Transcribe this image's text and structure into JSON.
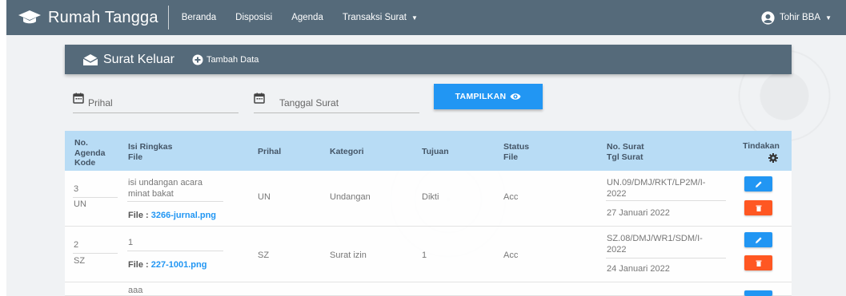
{
  "navbar": {
    "brand": "Rumah Tangga",
    "items": [
      "Beranda",
      "Disposisi",
      "Agenda",
      "Transaksi Surat"
    ],
    "user": "Tohir BBA"
  },
  "panel": {
    "title": "Surat Keluar",
    "add_label": "Tambah Data"
  },
  "filter": {
    "prihal_placeholder": "Prihal",
    "tanggal_placeholder": "Tanggal Surat",
    "button_label": "TAMPILKAN"
  },
  "table": {
    "headers": {
      "no_agenda": "No.",
      "no_agenda_2": "Agenda",
      "kode": "Kode",
      "isi": "Isi Ringkas",
      "file": "File",
      "prihal": "Prihal",
      "kategori": "Kategori",
      "tujuan": "Tujuan",
      "status": "Status",
      "status_2": "File",
      "no_surat": "No. Surat",
      "tgl_surat": "Tgl Surat",
      "tindakan": "Tindakan"
    },
    "file_label": "File : ",
    "rows": [
      {
        "no": "3",
        "kode": "UN",
        "isi_1": "isi undangan acara",
        "isi_2": "minat bakat",
        "file": "3266-jurnal.png",
        "prihal": "UN",
        "kategori": "Undangan",
        "tujuan": "Dikti",
        "status": "Acc",
        "no_surat_1": "UN.09/DMJ/RKT/LP2M/I-",
        "no_surat_2": "2022",
        "tgl": "27 Januari 2022"
      },
      {
        "no": "2",
        "kode": "SZ",
        "isi_1": "1",
        "isi_2": "",
        "file": "227-1001.png",
        "prihal": "SZ",
        "kategori": "Surat izin",
        "tujuan": "1",
        "status": "Acc",
        "no_surat_1": "SZ.08/DMJ/WR1/SDM/I-",
        "no_surat_2": "2022",
        "tgl": "24 Januari 2022"
      },
      {
        "isi_1": "aaa"
      }
    ]
  },
  "colors": {
    "navbar": "#556a7a",
    "header_row": "#b8dcf5",
    "primary": "#2196f3",
    "danger": "#ff5722"
  },
  "icons": {
    "brand": "graduation-cap-icon",
    "user": "user-circle-icon",
    "panel": "envelope-open-icon",
    "add": "plus-circle-icon",
    "filter": "calendar-icon",
    "show": "eye-icon",
    "settings": "gear-icon",
    "edit": "pencil-icon",
    "delete": "trash-icon"
  }
}
